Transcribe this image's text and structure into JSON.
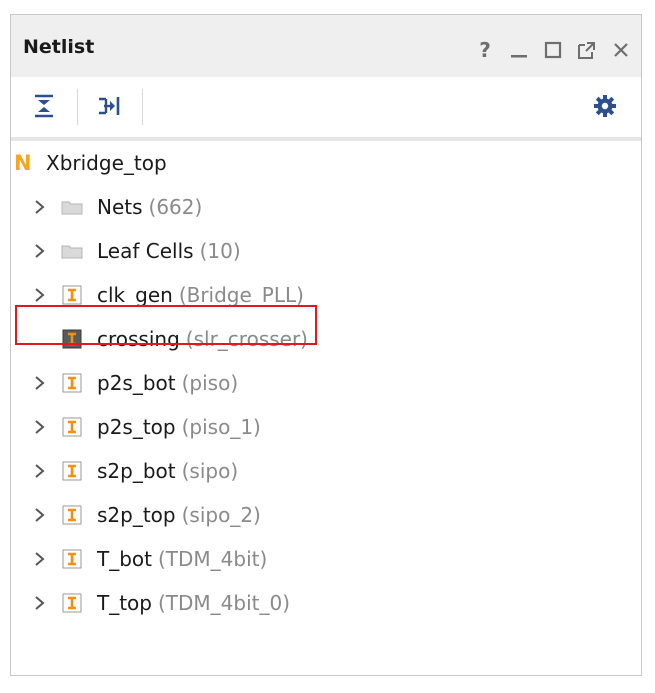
{
  "panel": {
    "title": "Netlist",
    "help_glyph": "?"
  },
  "toolbar": {
    "collapse_all_icon": "collapse-all-icon",
    "expand_icon": "expand-icon",
    "settings_icon": "gear-icon",
    "accent": "#2b4f8f"
  },
  "tree": {
    "root": {
      "prefix": "N",
      "label": "Xbridge_top"
    },
    "items": [
      {
        "name": "Nets",
        "detail": "(662)",
        "kind": "folder",
        "expandable": true
      },
      {
        "name": "Leaf Cells",
        "detail": "(10)",
        "kind": "folder",
        "expandable": true
      },
      {
        "name": "clk_gen",
        "detail": "(Bridge_PLL)",
        "kind": "instance",
        "expandable": true
      },
      {
        "name": "crossing",
        "detail": "(slr_crosser)",
        "kind": "instance-black",
        "expandable": false,
        "highlighted": true
      },
      {
        "name": "p2s_bot",
        "detail": "(piso)",
        "kind": "instance",
        "expandable": true
      },
      {
        "name": "p2s_top",
        "detail": "(piso_1)",
        "kind": "instance",
        "expandable": true
      },
      {
        "name": "s2p_bot",
        "detail": "(sipo)",
        "kind": "instance",
        "expandable": true
      },
      {
        "name": "s2p_top",
        "detail": "(sipo_2)",
        "kind": "instance",
        "expandable": true
      },
      {
        "name": "T_bot",
        "detail": "(TDM_4bit)",
        "kind": "instance",
        "expandable": true
      },
      {
        "name": "T_top",
        "detail": "(TDM_4bit_0)",
        "kind": "instance",
        "expandable": true
      }
    ]
  },
  "colors": {
    "root_accent": "#f5a623",
    "instance_orange": "#f29111",
    "highlight_border": "#e0191e",
    "muted_text": "#8a8a8a"
  }
}
